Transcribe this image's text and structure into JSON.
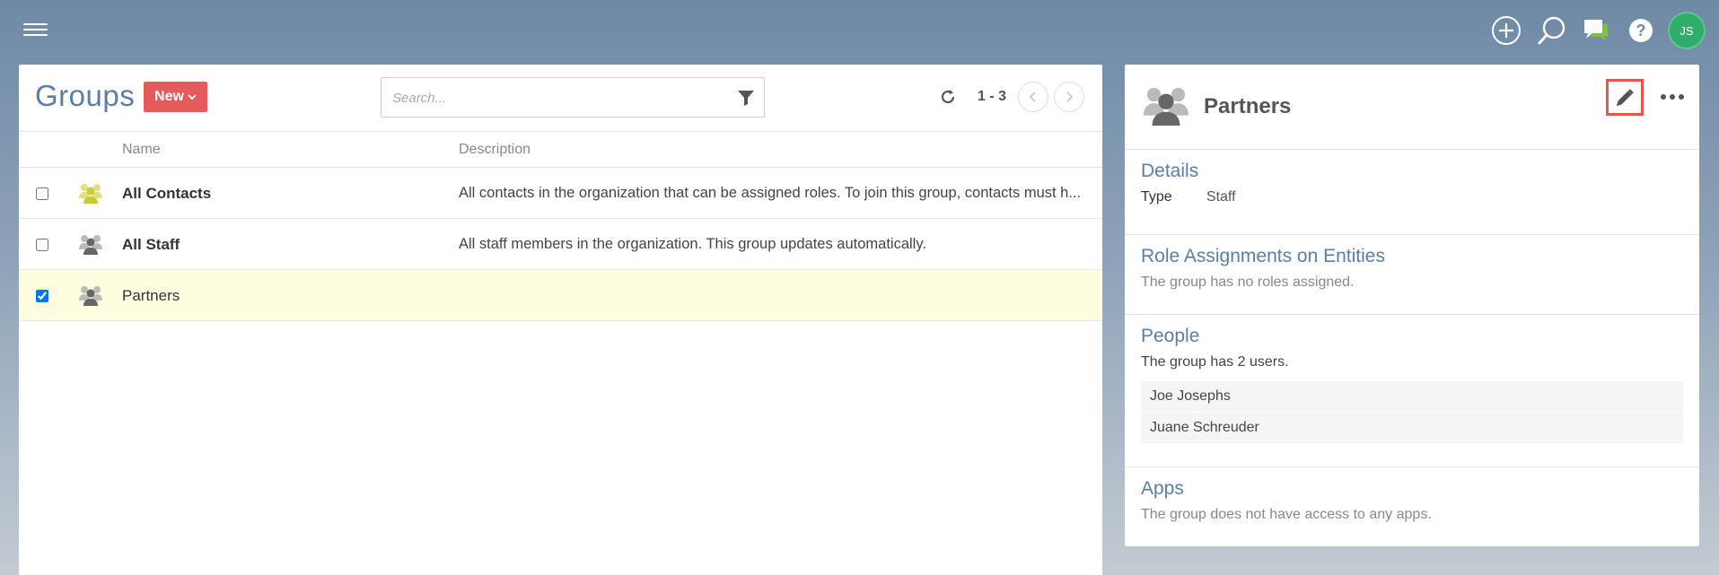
{
  "topbar": {
    "avatar_initials": "JS",
    "icons": [
      "add-icon",
      "search-icon",
      "chat-icon",
      "help-icon"
    ]
  },
  "groups_list": {
    "title": "Groups",
    "new_label": "New",
    "search_placeholder": "Search...",
    "pager": "1 - 3",
    "columns": {
      "name": "Name",
      "description": "Description"
    },
    "rows": [
      {
        "name": "All Contacts",
        "description": "All contacts in the organization that can be assigned roles. To join this group, contacts must h...",
        "checked": false,
        "icon_color": "#c9c93a"
      },
      {
        "name": "All Staff",
        "description": "All staff members in the organization. This group updates automatically.",
        "checked": false,
        "icon_color": "#777777"
      },
      {
        "name": "Partners",
        "description": "",
        "checked": true,
        "icon_color": "#777777"
      }
    ]
  },
  "detail": {
    "title": "Partners",
    "details": {
      "heading": "Details",
      "type_label": "Type",
      "type_value": "Staff"
    },
    "roles": {
      "heading": "Role Assignments on Entities",
      "text": "The group has no roles assigned."
    },
    "people": {
      "heading": "People",
      "text": "The group has 2 users.",
      "users": [
        "Joe Josephs",
        "Juane Schreuder"
      ]
    },
    "apps": {
      "heading": "Apps",
      "text": "The group does not have access to any apps."
    }
  },
  "colors": {
    "accent": "#5a7ea8",
    "new_button": "#e55b5b",
    "avatar": "#2fae6b",
    "selected_row": "#fdfde0",
    "edit_highlight": "#e8554e"
  }
}
